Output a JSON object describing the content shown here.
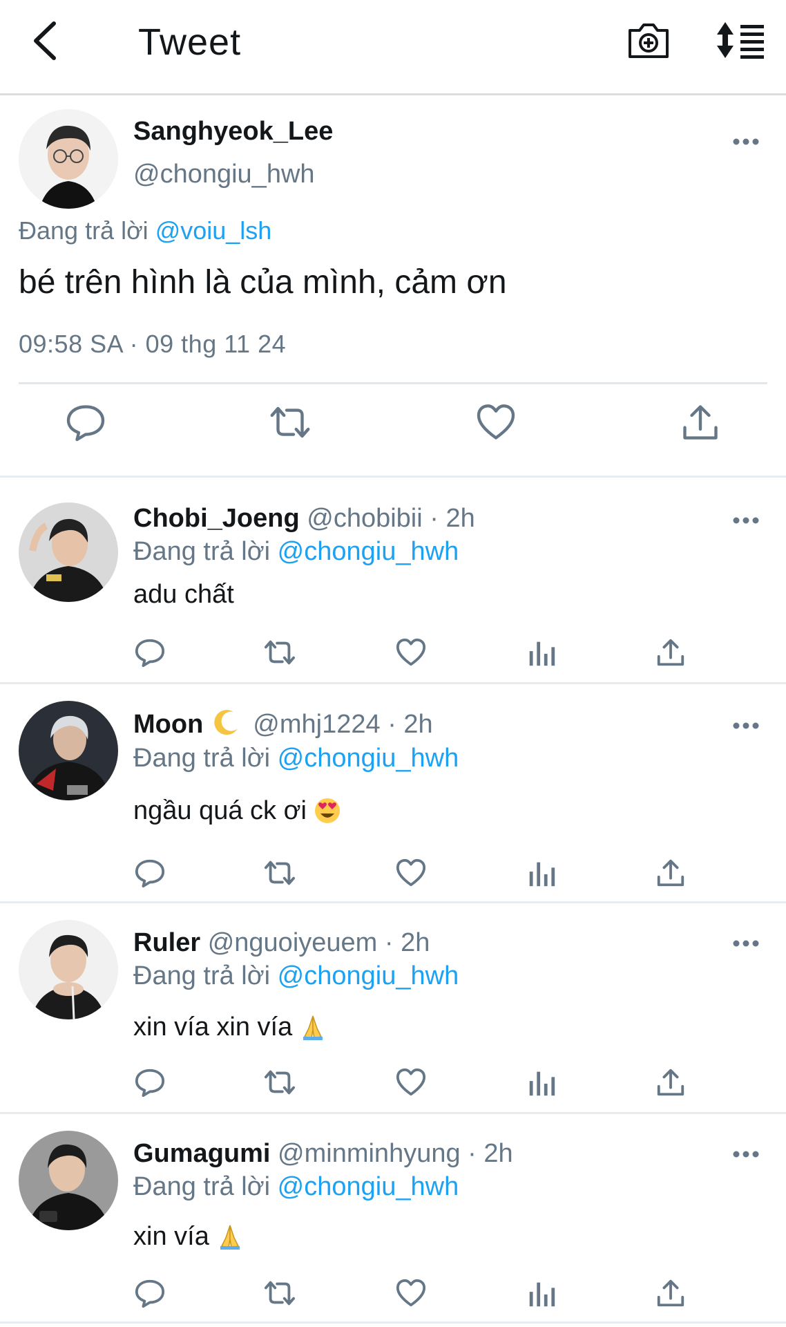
{
  "header": {
    "title": "Tweet"
  },
  "main_tweet": {
    "name": "Sanghyeok_Lee",
    "handle": "@chongiu_hwh",
    "reply_prefix": "Đang trả lời",
    "reply_to": "@voiu_lsh",
    "text": "bé trên hình là của mình, cảm ơn",
    "timestamp": "09:58 SA · 09 thg 11 24"
  },
  "replies": [
    {
      "name": "Chobi_Joeng",
      "meta": "@chobibii · 2h",
      "reply_prefix": "Đang trả lời",
      "reply_to": "@chongiu_hwh",
      "text": "adu chất"
    },
    {
      "name": "Moon",
      "meta": "@mhj1224 · 2h",
      "reply_prefix": "Đang trả lời",
      "reply_to": "@chongiu_hwh",
      "text": "ngầu quá ck ơi"
    },
    {
      "name": "Ruler",
      "meta": "@nguoiyeuem · 2h",
      "reply_prefix": "Đang trả lời",
      "reply_to": "@chongiu_hwh",
      "text": "xin vía xin vía"
    },
    {
      "name": "Gumagumi",
      "meta": "@minminhyung · 2h",
      "reply_prefix": "Đang trả lời",
      "reply_to": "@chongiu_hwh",
      "text": "xin vía"
    }
  ],
  "colors": {
    "link": "#1da1f2",
    "secondary_text": "#657786",
    "primary_text": "#14171a",
    "divider": "#e6ecf0"
  },
  "icons": [
    "back-arrow-icon",
    "camera-icon",
    "sort-icon",
    "more-icon",
    "reply-icon",
    "retweet-icon",
    "like-icon",
    "analytics-icon",
    "share-icon",
    "crescent-moon-emoji",
    "heart-eyes-emoji",
    "folded-hands-emoji"
  ]
}
